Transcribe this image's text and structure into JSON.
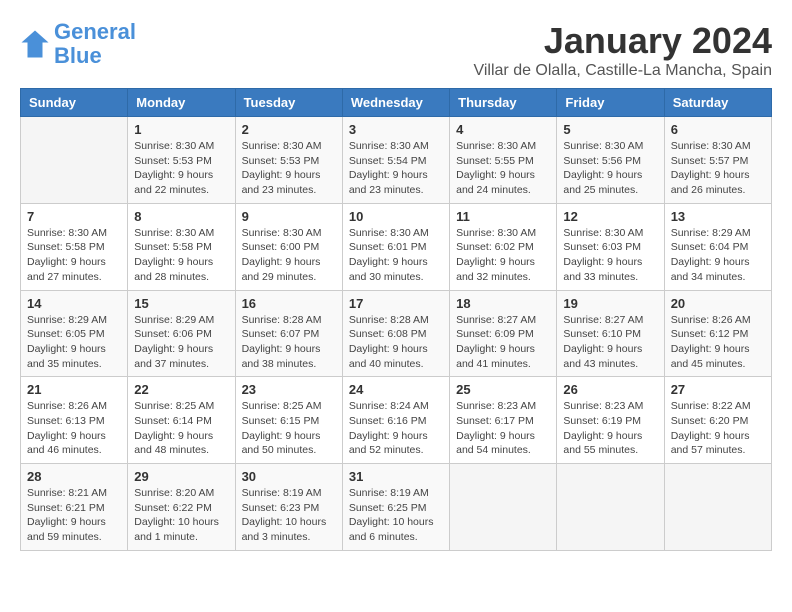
{
  "logo": {
    "line1": "General",
    "line2": "Blue"
  },
  "title": "January 2024",
  "subtitle": "Villar de Olalla, Castille-La Mancha, Spain",
  "days_of_week": [
    "Sunday",
    "Monday",
    "Tuesday",
    "Wednesday",
    "Thursday",
    "Friday",
    "Saturday"
  ],
  "weeks": [
    [
      {
        "day": "",
        "info": ""
      },
      {
        "day": "1",
        "info": "Sunrise: 8:30 AM\nSunset: 5:53 PM\nDaylight: 9 hours\nand 22 minutes."
      },
      {
        "day": "2",
        "info": "Sunrise: 8:30 AM\nSunset: 5:53 PM\nDaylight: 9 hours\nand 23 minutes."
      },
      {
        "day": "3",
        "info": "Sunrise: 8:30 AM\nSunset: 5:54 PM\nDaylight: 9 hours\nand 23 minutes."
      },
      {
        "day": "4",
        "info": "Sunrise: 8:30 AM\nSunset: 5:55 PM\nDaylight: 9 hours\nand 24 minutes."
      },
      {
        "day": "5",
        "info": "Sunrise: 8:30 AM\nSunset: 5:56 PM\nDaylight: 9 hours\nand 25 minutes."
      },
      {
        "day": "6",
        "info": "Sunrise: 8:30 AM\nSunset: 5:57 PM\nDaylight: 9 hours\nand 26 minutes."
      }
    ],
    [
      {
        "day": "7",
        "info": ""
      },
      {
        "day": "8",
        "info": "Sunrise: 8:30 AM\nSunset: 5:58 PM\nDaylight: 9 hours\nand 28 minutes."
      },
      {
        "day": "9",
        "info": "Sunrise: 8:30 AM\nSunset: 6:00 PM\nDaylight: 9 hours\nand 29 minutes."
      },
      {
        "day": "10",
        "info": "Sunrise: 8:30 AM\nSunset: 6:01 PM\nDaylight: 9 hours\nand 30 minutes."
      },
      {
        "day": "11",
        "info": "Sunrise: 8:30 AM\nSunset: 6:02 PM\nDaylight: 9 hours\nand 32 minutes."
      },
      {
        "day": "12",
        "info": "Sunrise: 8:30 AM\nSunset: 6:03 PM\nDaylight: 9 hours\nand 33 minutes."
      },
      {
        "day": "13",
        "info": "Sunrise: 8:29 AM\nSunset: 6:04 PM\nDaylight: 9 hours\nand 34 minutes."
      }
    ],
    [
      {
        "day": "14",
        "info": ""
      },
      {
        "day": "15",
        "info": "Sunrise: 8:29 AM\nSunset: 6:06 PM\nDaylight: 9 hours\nand 37 minutes."
      },
      {
        "day": "16",
        "info": "Sunrise: 8:28 AM\nSunset: 6:07 PM\nDaylight: 9 hours\nand 38 minutes."
      },
      {
        "day": "17",
        "info": "Sunrise: 8:28 AM\nSunset: 6:08 PM\nDaylight: 9 hours\nand 40 minutes."
      },
      {
        "day": "18",
        "info": "Sunrise: 8:27 AM\nSunset: 6:09 PM\nDaylight: 9 hours\nand 41 minutes."
      },
      {
        "day": "19",
        "info": "Sunrise: 8:27 AM\nSunset: 6:10 PM\nDaylight: 9 hours\nand 43 minutes."
      },
      {
        "day": "20",
        "info": "Sunrise: 8:26 AM\nSunset: 6:12 PM\nDaylight: 9 hours\nand 45 minutes."
      }
    ],
    [
      {
        "day": "21",
        "info": ""
      },
      {
        "day": "22",
        "info": "Sunrise: 8:25 AM\nSunset: 6:14 PM\nDaylight: 9 hours\nand 48 minutes."
      },
      {
        "day": "23",
        "info": "Sunrise: 8:25 AM\nSunset: 6:15 PM\nDaylight: 9 hours\nand 50 minutes."
      },
      {
        "day": "24",
        "info": "Sunrise: 8:24 AM\nSunset: 6:16 PM\nDaylight: 9 hours\nand 52 minutes."
      },
      {
        "day": "25",
        "info": "Sunrise: 8:23 AM\nSunset: 6:17 PM\nDaylight: 9 hours\nand 54 minutes."
      },
      {
        "day": "26",
        "info": "Sunrise: 8:23 AM\nSunset: 6:19 PM\nDaylight: 9 hours\nand 55 minutes."
      },
      {
        "day": "27",
        "info": "Sunrise: 8:22 AM\nSunset: 6:20 PM\nDaylight: 9 hours\nand 57 minutes."
      }
    ],
    [
      {
        "day": "28",
        "info": ""
      },
      {
        "day": "29",
        "info": "Sunrise: 8:20 AM\nSunset: 6:22 PM\nDaylight: 10 hours\nand 1 minute."
      },
      {
        "day": "30",
        "info": "Sunrise: 8:19 AM\nSunset: 6:23 PM\nDaylight: 10 hours\nand 3 minutes."
      },
      {
        "day": "31",
        "info": "Sunrise: 8:19 AM\nSunset: 6:25 PM\nDaylight: 10 hours\nand 6 minutes."
      },
      {
        "day": "",
        "info": ""
      },
      {
        "day": "",
        "info": ""
      },
      {
        "day": "",
        "info": ""
      }
    ]
  ],
  "week7_sunday_info": "Sunrise: 8:30 AM\nSunset: 5:58 PM\nDaylight: 9 hours\nand 27 minutes.",
  "week14_sunday_info": "Sunrise: 8:29 AM\nSunset: 6:05 PM\nDaylight: 9 hours\nand 35 minutes.",
  "week21_sunday_info": "Sunrise: 8:26 AM\nSunset: 6:13 PM\nDaylight: 9 hours\nand 46 minutes.",
  "week28_sunday_info": "Sunrise: 8:21 AM\nSunset: 6:21 PM\nDaylight: 9 hours\nand 59 minutes."
}
